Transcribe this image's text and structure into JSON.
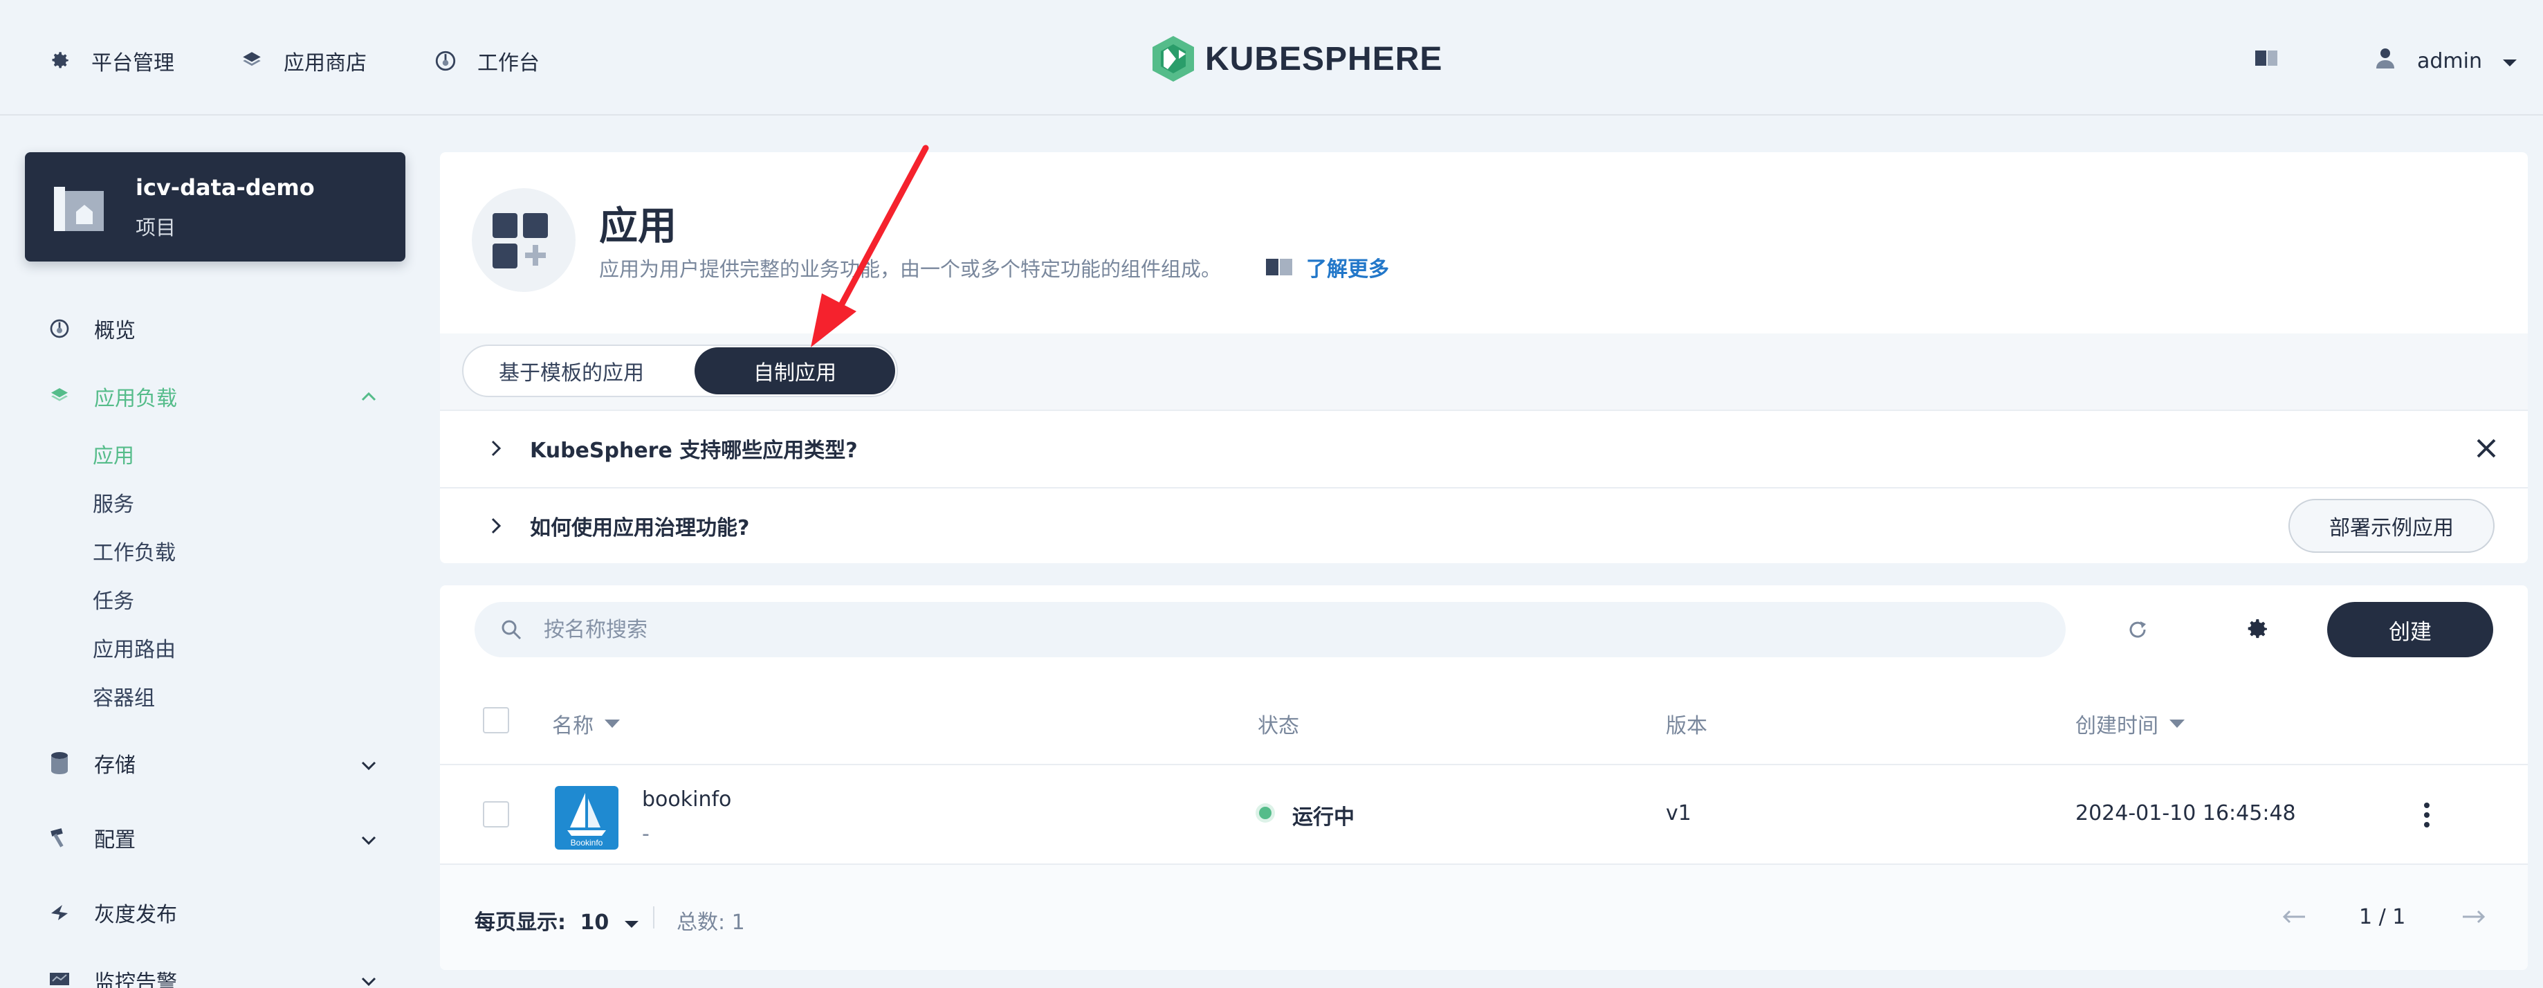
{
  "topnav": {
    "items": [
      {
        "label": "平台管理",
        "icon": "gear-icon"
      },
      {
        "label": "应用商店",
        "icon": "layers-icon"
      },
      {
        "label": "工作台",
        "icon": "dashboard-icon"
      }
    ],
    "logo_text": "KUBESPHERE",
    "user": "admin"
  },
  "sidebar": {
    "project_name": "icv-data-demo",
    "project_type": "项目",
    "items": [
      {
        "label": "概览",
        "icon": "dashboard-icon"
      },
      {
        "label": "应用负载",
        "icon": "layers-icon",
        "active": true
      },
      {
        "label": "存储",
        "icon": "database-icon"
      },
      {
        "label": "配置",
        "icon": "hammer-icon"
      },
      {
        "label": "灰度发布",
        "icon": "bird-icon"
      },
      {
        "label": "监控告警",
        "icon": "monitor-icon"
      }
    ],
    "sub_items": [
      "应用",
      "服务",
      "工作负载",
      "任务",
      "应用路由",
      "容器组"
    ]
  },
  "banner": {
    "title": "应用",
    "description": "应用为用户提供完整的业务功能，由一个或多个特定功能的组件组成。",
    "learn_more": "了解更多",
    "tabs": [
      "基于模板的应用",
      "自制应用"
    ],
    "active_tab": "自制应用",
    "faq": [
      "KubeSphere 支持哪些应用类型?",
      "如何使用应用治理功能?"
    ],
    "deploy_sample": "部署示例应用"
  },
  "list": {
    "search_placeholder": "按名称搜索",
    "create_label": "创建",
    "columns": [
      "名称",
      "状态",
      "版本",
      "创建时间"
    ],
    "rows": [
      {
        "name": "bookinfo",
        "description": "-",
        "icon_label": "Bookinfo",
        "status": "运行中",
        "version": "v1",
        "created": "2024-01-10 16:45:48"
      }
    ],
    "footer": {
      "page_size_label": "每页显示:",
      "page_size": "10",
      "total": "总数: 1",
      "page": "1 / 1"
    }
  },
  "colors": {
    "accent": "#55bc8a",
    "dark": "#242e42",
    "link": "#2277c9",
    "annotation": "#f5222d"
  }
}
